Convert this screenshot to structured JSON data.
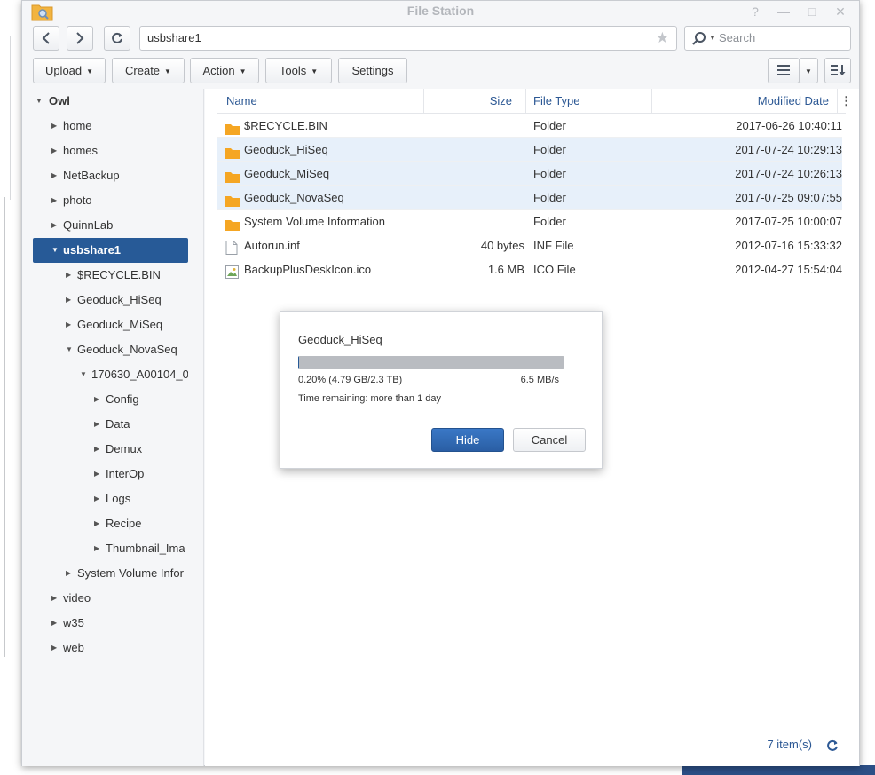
{
  "window": {
    "title": "File Station",
    "help": "?",
    "minimize": "—",
    "maximize": "□",
    "close": "✕"
  },
  "nav": {
    "path": "usbshare1",
    "search_placeholder": "Search"
  },
  "toolbar": {
    "upload": "Upload",
    "create": "Create",
    "action": "Action",
    "tools": "Tools",
    "settings": "Settings"
  },
  "tree": {
    "root": "Owl",
    "items": [
      {
        "label": "home"
      },
      {
        "label": "homes"
      },
      {
        "label": "NetBackup"
      },
      {
        "label": "photo"
      },
      {
        "label": "QuinnLab"
      },
      {
        "label": "usbshare1"
      },
      {
        "label": "$RECYCLE.BIN"
      },
      {
        "label": "Geoduck_HiSeq"
      },
      {
        "label": "Geoduck_MiSeq"
      },
      {
        "label": "Geoduck_NovaSeq"
      },
      {
        "label": "170630_A00104_0"
      },
      {
        "label": "Config"
      },
      {
        "label": "Data"
      },
      {
        "label": "Demux"
      },
      {
        "label": "InterOp"
      },
      {
        "label": "Logs"
      },
      {
        "label": "Recipe"
      },
      {
        "label": "Thumbnail_Ima"
      },
      {
        "label": "System Volume Infor"
      },
      {
        "label": "video"
      },
      {
        "label": "w35"
      },
      {
        "label": "web"
      }
    ]
  },
  "columns": {
    "name": "Name",
    "size": "Size",
    "type": "File Type",
    "date": "Modified Date",
    "menu": "⋮"
  },
  "files": [
    {
      "name": "$RECYCLE.BIN",
      "size": "",
      "type": "Folder",
      "date": "2017-06-26 10:40:11"
    },
    {
      "name": "Geoduck_HiSeq",
      "size": "",
      "type": "Folder",
      "date": "2017-07-24 10:29:13"
    },
    {
      "name": "Geoduck_MiSeq",
      "size": "",
      "type": "Folder",
      "date": "2017-07-24 10:26:13"
    },
    {
      "name": "Geoduck_NovaSeq",
      "size": "",
      "type": "Folder",
      "date": "2017-07-25 09:07:55"
    },
    {
      "name": "System Volume Information",
      "size": "",
      "type": "Folder",
      "date": "2017-07-25 10:00:07"
    },
    {
      "name": "Autorun.inf",
      "size": "40 bytes",
      "type": "INF File",
      "date": "2012-07-16 15:33:32"
    },
    {
      "name": "BackupPlusDeskIcon.ico",
      "size": "1.6 MB",
      "type": "ICO File",
      "date": "2012-04-27 15:54:04"
    }
  ],
  "footer": {
    "count": "7 item(s)"
  },
  "dialog": {
    "title": "Geoduck_HiSeq",
    "progress_percent": 0.2,
    "progress_text": "0.20% (4.79 GB/2.3 TB)",
    "speed": "6.5 MB/s",
    "time_remaining": "Time remaining: more than 1 day",
    "hide": "Hide",
    "cancel": "Cancel"
  },
  "colors": {
    "accent": "#275a97",
    "selected_row": "#e7f0fa",
    "folder": "#f5a623",
    "header_text": "#2c5894"
  }
}
